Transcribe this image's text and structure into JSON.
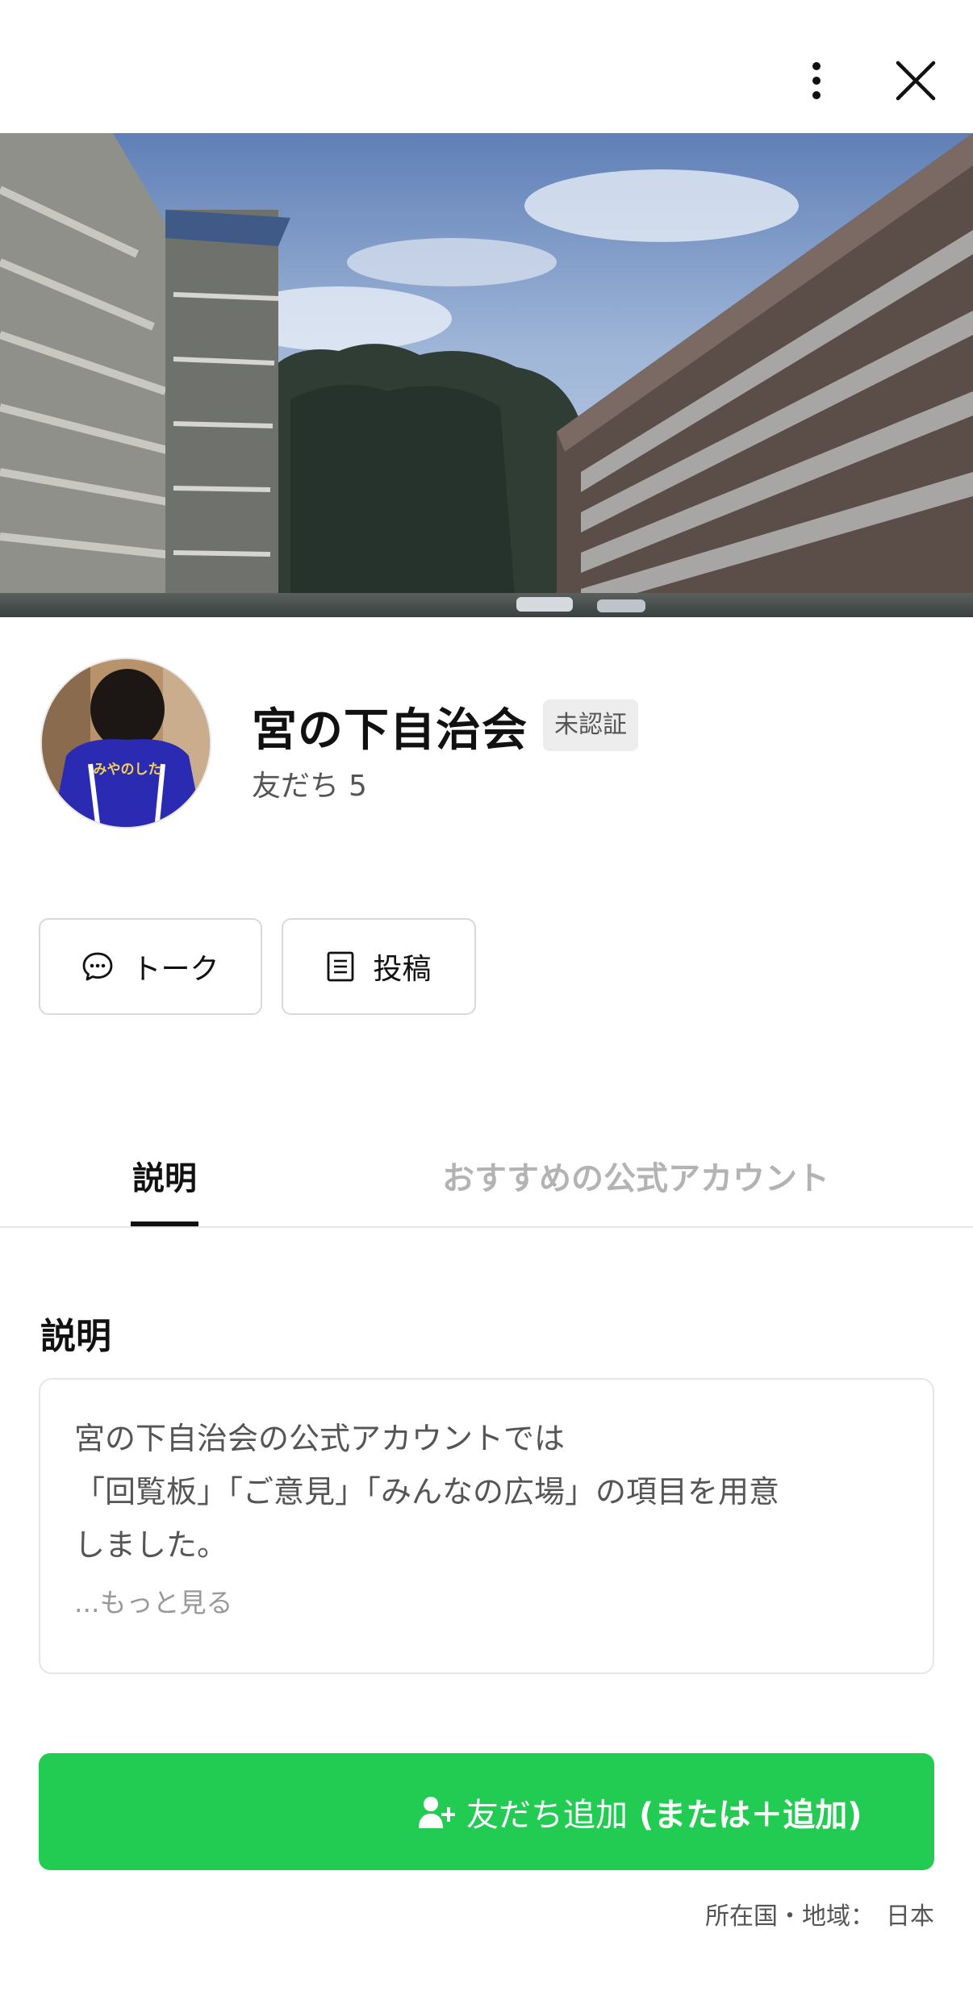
{
  "header": {
    "more_icon": "vertical-dots-icon",
    "close_icon": "close-icon"
  },
  "profile": {
    "name": "宮の下自治会",
    "badge": "未認証",
    "friends_label": "友だち",
    "friends_count": "5",
    "avatar_text": "みやのした"
  },
  "actions": {
    "talk_label": "トーク",
    "post_label": "投稿"
  },
  "tabs": [
    {
      "label": "説明",
      "active": true
    },
    {
      "label": "おすすめの公式アカウント",
      "active": false
    }
  ],
  "description": {
    "title": "説明",
    "lines": [
      "宮の下自治会の公式アカウントでは",
      "「回覧板」「ご意見」「みんなの広場」の項目を用意",
      "しました。"
    ],
    "more_label": "...もっと見る"
  },
  "add_friend": {
    "label": "友だち追加",
    "hint": "(または＋追加)",
    "color": "#22cb51"
  },
  "region": {
    "label": "所在国・地域：",
    "value": "日本"
  }
}
